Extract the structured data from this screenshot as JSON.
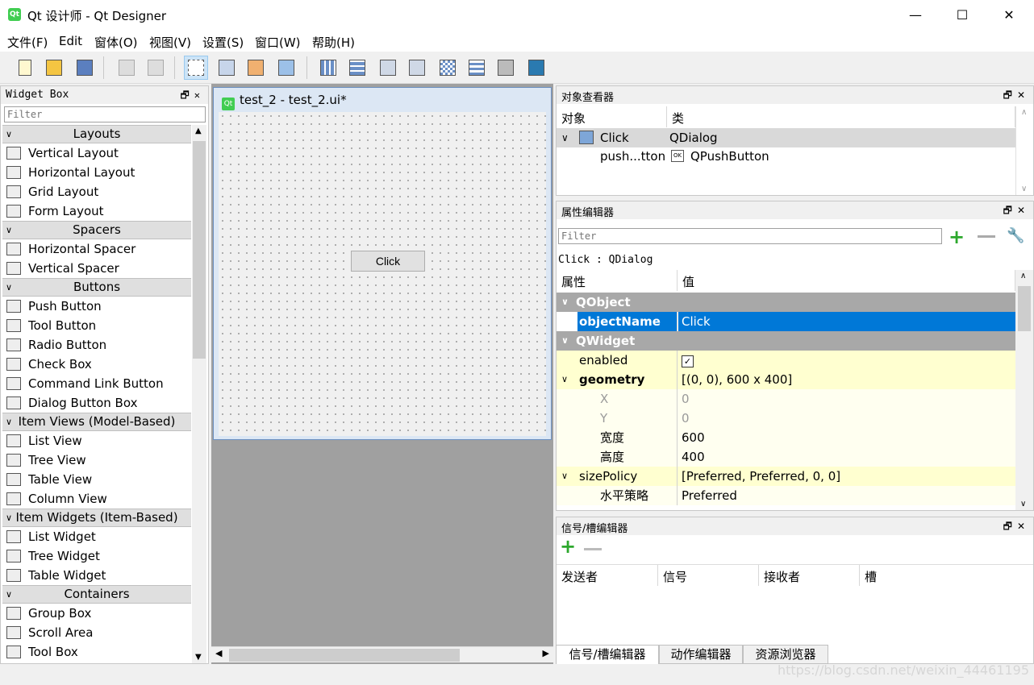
{
  "window": {
    "logo": "Qt",
    "title": "Qt 设计师 - Qt Designer",
    "minimize": "—",
    "maximize": "☐",
    "close": "✕"
  },
  "menu": [
    "文件(F)",
    "Edit",
    "窗体(O)",
    "视图(V)",
    "设置(S)",
    "窗口(W)",
    "帮助(H)"
  ],
  "widget_box": {
    "title": "Widget Box",
    "filter_placeholder": "Filter",
    "categories": [
      {
        "name": "Layouts",
        "items": [
          "Vertical Layout",
          "Horizontal Layout",
          "Grid Layout",
          "Form Layout"
        ]
      },
      {
        "name": "Spacers",
        "items": [
          "Horizontal Spacer",
          "Vertical Spacer"
        ]
      },
      {
        "name": "Buttons",
        "items": [
          "Push Button",
          "Tool Button",
          "Radio Button",
          "Check Box",
          "Command Link Button",
          "Dialog Button Box"
        ]
      },
      {
        "name": "Item Views (Model-Based)",
        "items": [
          "List View",
          "Tree View",
          "Table View",
          "Column View"
        ]
      },
      {
        "name": "Item Widgets (Item-Based)",
        "items": [
          "List Widget",
          "Tree Widget",
          "Table Widget"
        ]
      },
      {
        "name": "Containers",
        "items": [
          "Group Box",
          "Scroll Area",
          "Tool Box"
        ]
      }
    ]
  },
  "form": {
    "logo": "Qt",
    "title": "test_2 - test_2.ui*",
    "button_label": "Click"
  },
  "object_inspector": {
    "title": "对象查看器",
    "col_object": "对象",
    "col_class": "类",
    "rows": [
      {
        "object": "Click",
        "class": "QDialog"
      },
      {
        "object": "push...tton",
        "class": "QPushButton"
      }
    ]
  },
  "property_editor": {
    "title": "属性编辑器",
    "filter_placeholder": "Filter",
    "context": "Click : QDialog",
    "col_prop": "属性",
    "col_value": "值",
    "rows": [
      {
        "kind": "group",
        "name": "QObject",
        "value": ""
      },
      {
        "kind": "selected",
        "name": "objectName",
        "value": "Click"
      },
      {
        "kind": "group",
        "name": "QWidget",
        "value": ""
      },
      {
        "kind": "prop",
        "name": "enabled",
        "value": ""
      },
      {
        "kind": "prop-bold",
        "name": "geometry",
        "value": "[(0, 0), 600 x 400]"
      },
      {
        "kind": "sub-disabled",
        "name": "X",
        "value": "0"
      },
      {
        "kind": "sub-disabled",
        "name": "Y",
        "value": "0"
      },
      {
        "kind": "sub",
        "name": "宽度",
        "value": "600"
      },
      {
        "kind": "sub",
        "name": "高度",
        "value": "400"
      },
      {
        "kind": "prop",
        "name": "sizePolicy",
        "value": "[Preferred, Preferred, 0, 0]"
      },
      {
        "kind": "sub",
        "name": "水平策略",
        "value": "Preferred"
      }
    ]
  },
  "signal_editor": {
    "title": "信号/槽编辑器",
    "columns": [
      "发送者",
      "信号",
      "接收者",
      "槽"
    ]
  },
  "bottom_tabs": [
    "信号/槽编辑器",
    "动作编辑器",
    "资源浏览器"
  ],
  "watermark": "https://blog.csdn.net/weixin_44461195",
  "colors": {
    "selection": "#0078d7",
    "group_row": "#a8a8a8",
    "prop_row": "#ffffd0",
    "qt_green": "#41cd52"
  }
}
